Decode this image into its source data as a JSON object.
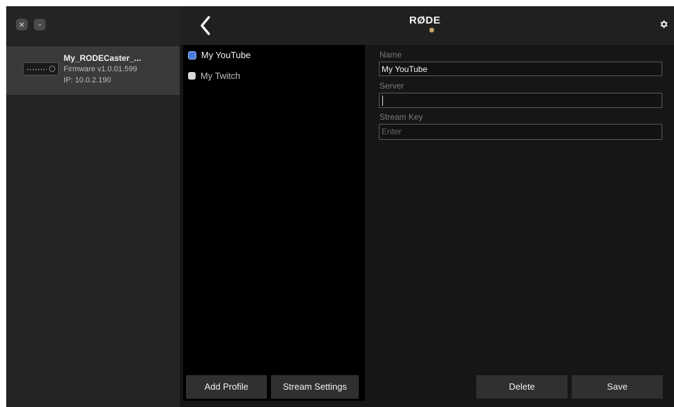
{
  "window": {
    "close_glyph": "×",
    "minimize_glyph": "–"
  },
  "device": {
    "name": "My_RODECaster_...",
    "firmware": "Firmware v1.0.01.599",
    "ip": "IP: 10.0.2.190"
  },
  "header": {
    "logo": "RØDE"
  },
  "profiles": [
    {
      "label": "My YouTube",
      "selected": true
    },
    {
      "label": "My Twitch",
      "selected": false
    }
  ],
  "form": {
    "name_label": "Name",
    "name_value": "My YouTube",
    "server_label": "Server",
    "server_value": "",
    "stream_key_label": "Stream Key",
    "stream_key_placeholder": "Enter"
  },
  "buttons": {
    "add_profile": "Add Profile",
    "stream_settings": "Stream Settings",
    "delete": "Delete",
    "save": "Save"
  },
  "colors": {
    "accent_blue": "#4a7be0",
    "logo_dot": "#c8a46a"
  }
}
